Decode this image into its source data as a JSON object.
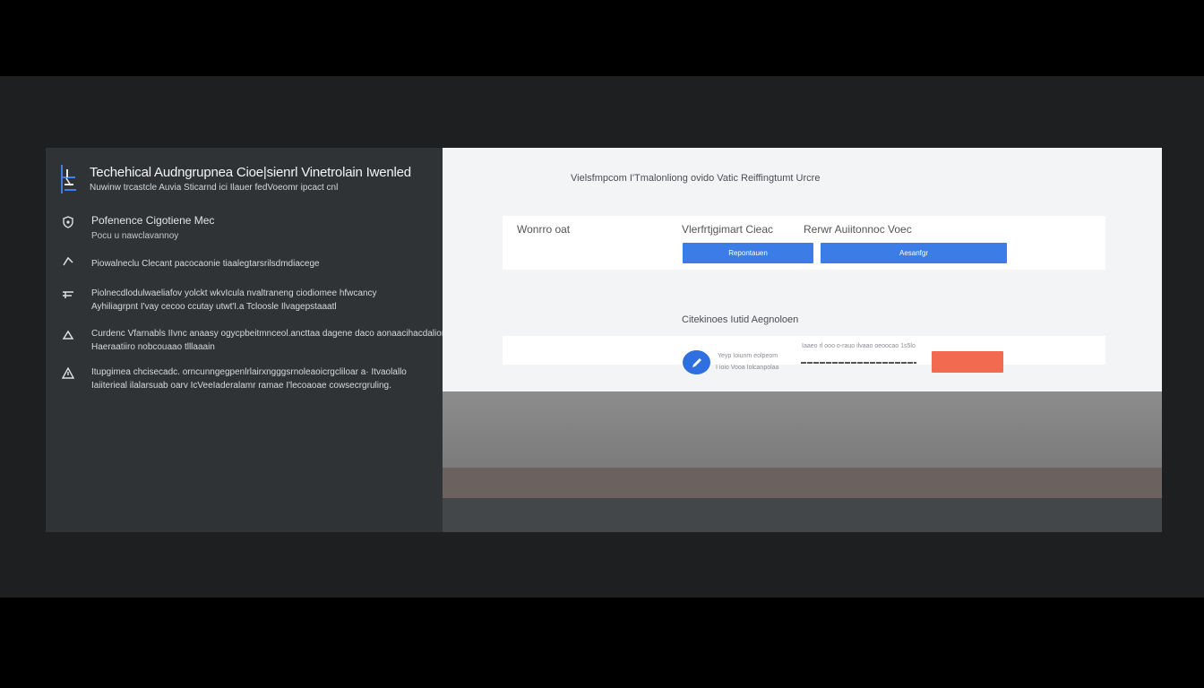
{
  "sidebar": {
    "title": "Techehical Audngrupnea  Cioe|sienrl Vinetrolain Iwenled",
    "subtitle": "Nuwinw trcastcle Auvia Sticarnd ici Ilauer fedVoeomr ipcact cnl",
    "items": [
      {
        "icon": "shield-icon",
        "line1": "Pofenence Cigotiene Mec",
        "line2": "Pocu u nawclavannoy"
      },
      {
        "icon": "chevron-icon",
        "line1": "Piowalneclu Clecant pacocaonie tiaalegtarsrilsdmdiacege",
        "line2": ""
      },
      {
        "icon": "list-icon",
        "line1": "Piolnecdlodulwaeliafov yolckt wkvIcula  nvaltraneng ciodiomee hfwcancy",
        "line2": "Ayhiliagrpnt  I'vay cecoo ccutay utwt'I.a Tcloosle Ilvagepstaaatl"
      },
      {
        "icon": "triangle-icon",
        "line1": "Curdenc Vfarnabls IIvnc anaasy ogycpbeitmnceol.ancttaa dagene daco aonaacihacdalioreeilt",
        "line2": "Haeraatiiro nobcouaao tlllaaain"
      },
      {
        "icon": "warning-icon",
        "line1": "Itupgimea chcisecadc.  orncunngegpenlrlairxngggsrnoleaoicrgcliloar a· Itvaolallo",
        "line2": "Iaiiterieal ilalarsuab oarv IcVeeIaderalamr ramae I'lecoaoae cowsecrgruling."
      }
    ]
  },
  "main": {
    "heading": "Vielsfmpcom I'Tmalonliong ovido Vatic Reiffingtumt Urcre",
    "card": {
      "label_left": "Wonrro oat",
      "label_mid": "Vlerfrtjgimart Cieac",
      "label_right": "Rerwr Auiitonnoc  Voec",
      "button_primary": "Repontauen",
      "button_secondary": "Aesanfgr"
    },
    "section_title": "Citekinoes Iutid Aegnoloen",
    "row": {
      "text1": "Yeyp Ioiunm eolpeom",
      "text2": "I ioio Vooa Iolcanpolaa",
      "field_label": "Iaaeo rl ooo o-rauo ilvaao oeoocao 1s5lo"
    }
  },
  "colors": {
    "accent_blue": "#3b7ce6",
    "accent_red": "#f26a4f",
    "sidebar_bg": "#303336"
  }
}
